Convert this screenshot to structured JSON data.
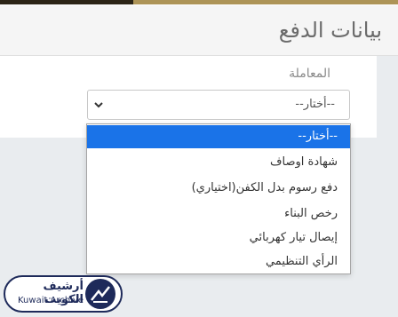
{
  "header": {
    "title": "بيانات الدفع"
  },
  "form": {
    "transaction_label": "المعاملة",
    "select_value": "--أختار--"
  },
  "dropdown": {
    "options": [
      "--أختار--",
      "شهادة اوصاف",
      "دفع رسوم بدل الكفن(اختياري)",
      "رخص البناء",
      "إيصال تيار كهربائي",
      "الرأي التنظيمي"
    ],
    "selected_index": 0
  },
  "watermark": {
    "arabic": "أرشيف الكويت",
    "english": "Kuwait Archive"
  },
  "colors": {
    "accent": "#ad9457",
    "selection": "#1a73e8",
    "logo": "#1e2a5a"
  },
  "icons": {
    "select_arrow": "chevron-down-icon",
    "logo": "kuwait-archive-logo-icon"
  }
}
